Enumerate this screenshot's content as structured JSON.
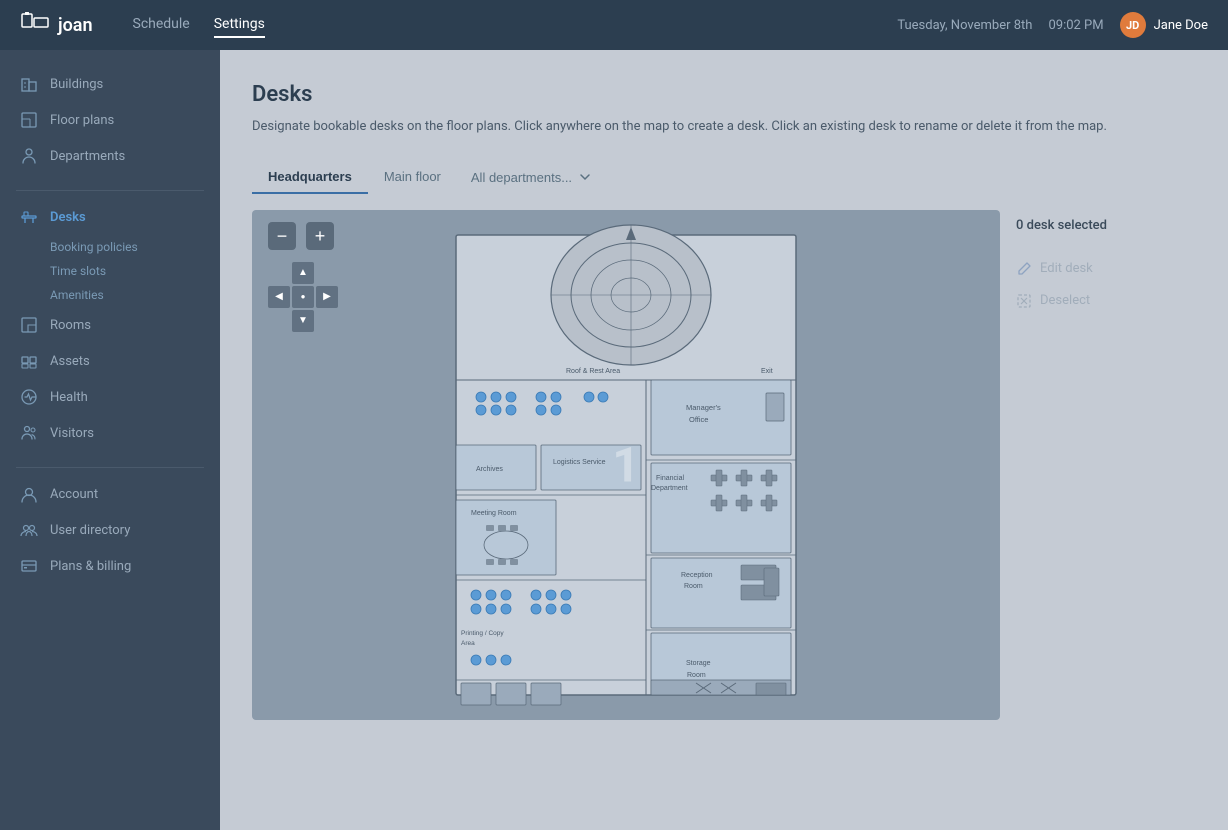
{
  "navbar": {
    "logo_text": "joan",
    "nav_items": [
      {
        "label": "Schedule",
        "active": false
      },
      {
        "label": "Settings",
        "active": true
      }
    ],
    "date": "Tuesday, November 8th",
    "time": "09:02 PM",
    "user_name": "Jane Doe",
    "user_initials": "JD"
  },
  "sidebar": {
    "sections": [
      {
        "items": [
          {
            "label": "Buildings",
            "icon": "buildings-icon",
            "active": false
          },
          {
            "label": "Floor plans",
            "icon": "floorplans-icon",
            "active": false
          },
          {
            "label": "Departments",
            "icon": "departments-icon",
            "active": false
          }
        ]
      },
      {
        "items": [
          {
            "label": "Desks",
            "icon": "desks-icon",
            "active": true,
            "sub": [
              "Booking policies",
              "Time slots",
              "Amenities"
            ]
          },
          {
            "label": "Rooms",
            "icon": "rooms-icon",
            "active": false
          },
          {
            "label": "Assets",
            "icon": "assets-icon",
            "active": false
          },
          {
            "label": "Health",
            "icon": "health-icon",
            "active": false
          },
          {
            "label": "Visitors",
            "icon": "visitors-icon",
            "active": false
          }
        ]
      },
      {
        "items": [
          {
            "label": "Account",
            "icon": "account-icon",
            "active": false
          },
          {
            "label": "User directory",
            "icon": "userdirectory-icon",
            "active": false
          },
          {
            "label": "Plans & billing",
            "icon": "billing-icon",
            "active": false
          }
        ]
      }
    ]
  },
  "content": {
    "title": "Desks",
    "description": "Designate bookable desks on the floor plans. Click anywhere on the map to create a desk. Click an existing desk to rename or delete it from the map.",
    "tabs": [
      {
        "label": "Headquarters",
        "active": true
      },
      {
        "label": "Main floor",
        "active": false
      },
      {
        "label": "All departments...",
        "active": false,
        "has_dropdown": true
      }
    ],
    "floor_label": "1",
    "zoom_minus": "−",
    "zoom_plus": "+",
    "desk_selected": "0 desk selected",
    "edit_desk_label": "Edit desk",
    "deselect_label": "Deselect"
  }
}
